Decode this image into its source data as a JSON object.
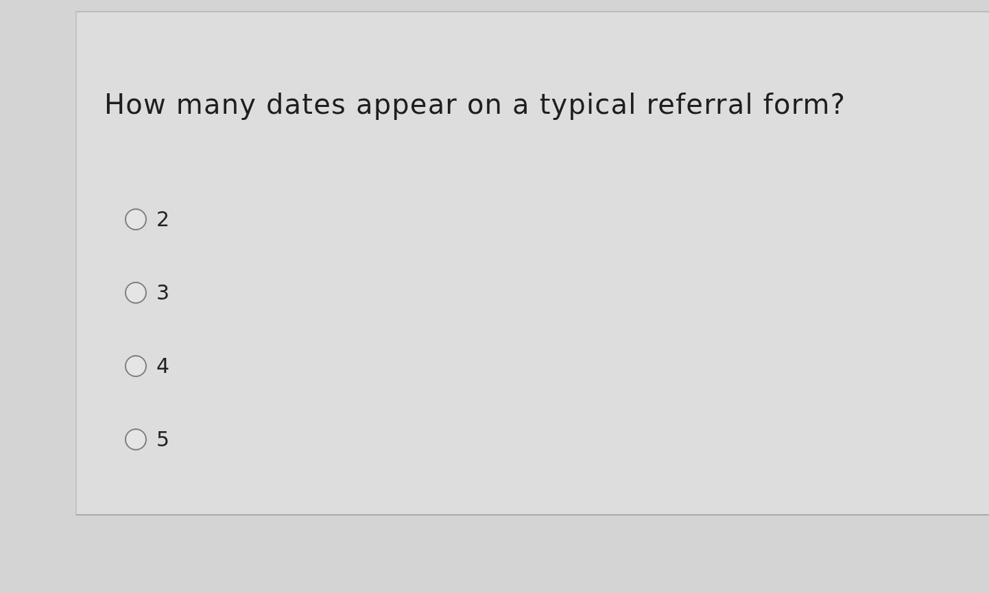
{
  "question": {
    "text": "How many dates appear on a typical referral form?",
    "options": [
      {
        "label": "2",
        "selected": false
      },
      {
        "label": "3",
        "selected": false
      },
      {
        "label": "4",
        "selected": false
      },
      {
        "label": "5",
        "selected": false
      }
    ]
  }
}
